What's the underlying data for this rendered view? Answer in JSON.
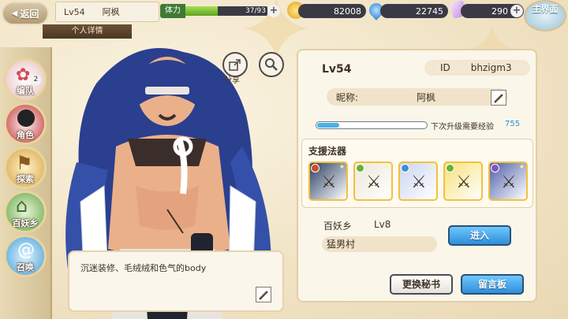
{
  "topbar": {
    "back_label": "返回",
    "player_level": "Lv54",
    "player_name": "阿枫",
    "stamina_label": "体力",
    "stamina_text": "37/93",
    "stamina_fraction": 0.398,
    "gold": "82008",
    "gems": "22745",
    "tickets": "290",
    "home_label": "主界面"
  },
  "detail_tab": "个人详情",
  "nav": {
    "items": [
      {
        "label": "编队",
        "icon": "team-icon",
        "badge": "2"
      },
      {
        "label": "角色",
        "icon": "character-icon"
      },
      {
        "label": "探索",
        "icon": "explore-icon"
      },
      {
        "label": "百妖乡",
        "icon": "village-icon"
      },
      {
        "label": "召唤",
        "icon": "summon-icon"
      }
    ]
  },
  "share_label": "分享",
  "quote": "沉迷装修、毛绒绒和色气的body",
  "profile": {
    "level": "Lv54",
    "id_label": "ID",
    "id_value": "bhzigm3",
    "nick_label": "昵称:",
    "nick_value": "阿枫",
    "exp_fraction": 0.2,
    "exp_label": "下次升级需要经验",
    "exp_value": "755",
    "support_title": "支援法器",
    "village_label": "百妖乡",
    "village_level": "Lv8",
    "village_name": "猛男村",
    "enter_label": "进入",
    "change_secretary_label": "更换秘书",
    "message_board_label": "留言板"
  },
  "cards": [
    {
      "name": "fan-weapon",
      "element": "#d14a2a",
      "bg": "#2a3f63",
      "stars": "★"
    },
    {
      "name": "spear-weapon",
      "element": "#64b23b",
      "bg": "#ece7d8",
      "stars": "★"
    },
    {
      "name": "blade-weapon",
      "element": "#3f8fd3",
      "bg": "#c9d5f0",
      "stars": "★"
    },
    {
      "name": "golden-weapon",
      "element": "#64b23b",
      "bg": "#f6e17a",
      "stars": "★★"
    },
    {
      "name": "dark-weapon",
      "element": "#8454c2",
      "bg": "#4f5fa8",
      "stars": "★"
    }
  ]
}
